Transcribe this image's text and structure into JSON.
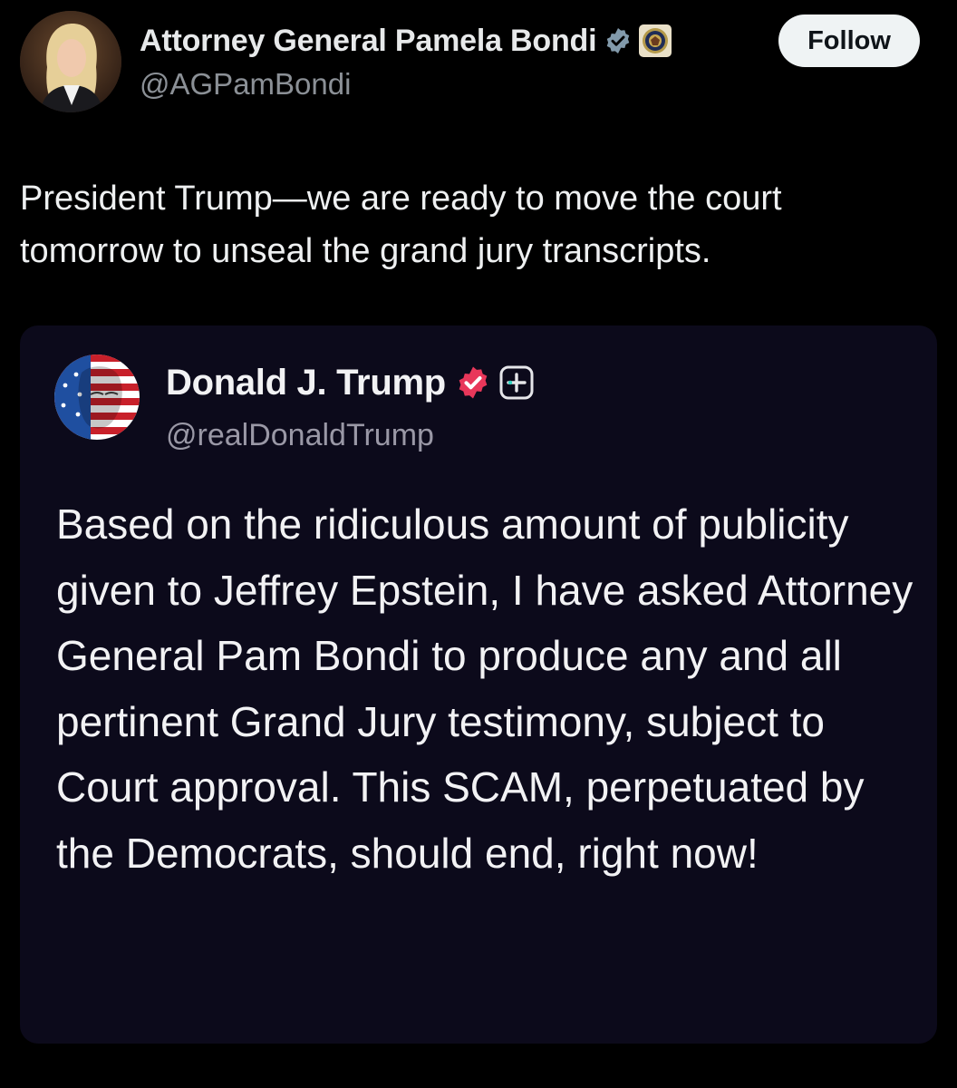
{
  "post": {
    "author_name": "Attorney General Pamela Bondi",
    "author_handle": "@AGPamBondi",
    "follow_label": "Follow",
    "text": "President Trump—we are ready to move the court tomorrow to unseal the grand jury transcripts.",
    "icons": [
      "verified-badge-icon",
      "doj-seal-icon"
    ]
  },
  "quote": {
    "author_name": "Donald J. Trump",
    "author_handle": "@realDonaldTrump",
    "text": "Based on the ridiculous amount of publicity given to Jeffrey Epstein, I have asked Attorney General Pam Bondi to produce any and all pertinent Grand Jury testimony, subject to Court approval. This SCAM, perpetuated by the Democrats, should end, right now!",
    "icons": [
      "truth-verified-badge-icon",
      "truth-plus-badge-icon"
    ]
  },
  "colors": {
    "background": "#000000",
    "card_background": "#0c0a1b",
    "verified_blue": "#829aab",
    "truth_badge": "#e8375a",
    "follow_bg": "#eff3f4",
    "secondary_text": "#8b9096"
  }
}
